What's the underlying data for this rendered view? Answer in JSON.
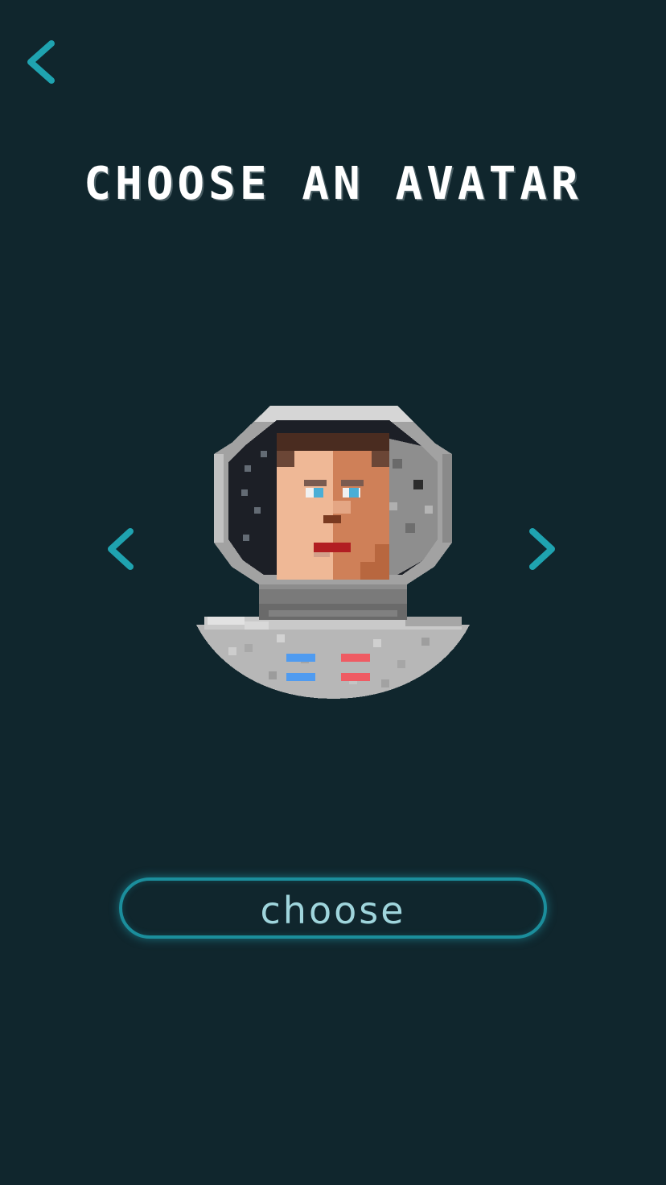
{
  "header": {
    "title": "CHOOSE AN AVATAR",
    "back_icon": "chevron-left-icon"
  },
  "carousel": {
    "prev_icon": "chevron-left-icon",
    "next_icon": "chevron-right-icon",
    "current_avatar": "astronaut-avatar"
  },
  "actions": {
    "choose_label": "choose"
  },
  "colors": {
    "background": "#10262d",
    "accent": "#1fa3b0",
    "button_border": "#1b8e9c",
    "button_text": "#9fd5dc",
    "title": "#ffffff"
  }
}
